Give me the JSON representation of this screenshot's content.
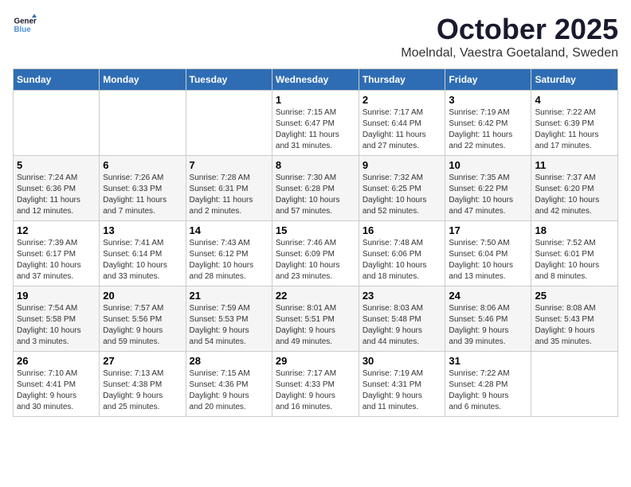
{
  "logo": {
    "line1": "General",
    "line2": "Blue"
  },
  "title": "October 2025",
  "location": "Moelndal, Vaestra Goetaland, Sweden",
  "headers": [
    "Sunday",
    "Monday",
    "Tuesday",
    "Wednesday",
    "Thursday",
    "Friday",
    "Saturday"
  ],
  "weeks": [
    [
      {
        "day": "",
        "info": ""
      },
      {
        "day": "",
        "info": ""
      },
      {
        "day": "",
        "info": ""
      },
      {
        "day": "1",
        "info": "Sunrise: 7:15 AM\nSunset: 6:47 PM\nDaylight: 11 hours\nand 31 minutes."
      },
      {
        "day": "2",
        "info": "Sunrise: 7:17 AM\nSunset: 6:44 PM\nDaylight: 11 hours\nand 27 minutes."
      },
      {
        "day": "3",
        "info": "Sunrise: 7:19 AM\nSunset: 6:42 PM\nDaylight: 11 hours\nand 22 minutes."
      },
      {
        "day": "4",
        "info": "Sunrise: 7:22 AM\nSunset: 6:39 PM\nDaylight: 11 hours\nand 17 minutes."
      }
    ],
    [
      {
        "day": "5",
        "info": "Sunrise: 7:24 AM\nSunset: 6:36 PM\nDaylight: 11 hours\nand 12 minutes."
      },
      {
        "day": "6",
        "info": "Sunrise: 7:26 AM\nSunset: 6:33 PM\nDaylight: 11 hours\nand 7 minutes."
      },
      {
        "day": "7",
        "info": "Sunrise: 7:28 AM\nSunset: 6:31 PM\nDaylight: 11 hours\nand 2 minutes."
      },
      {
        "day": "8",
        "info": "Sunrise: 7:30 AM\nSunset: 6:28 PM\nDaylight: 10 hours\nand 57 minutes."
      },
      {
        "day": "9",
        "info": "Sunrise: 7:32 AM\nSunset: 6:25 PM\nDaylight: 10 hours\nand 52 minutes."
      },
      {
        "day": "10",
        "info": "Sunrise: 7:35 AM\nSunset: 6:22 PM\nDaylight: 10 hours\nand 47 minutes."
      },
      {
        "day": "11",
        "info": "Sunrise: 7:37 AM\nSunset: 6:20 PM\nDaylight: 10 hours\nand 42 minutes."
      }
    ],
    [
      {
        "day": "12",
        "info": "Sunrise: 7:39 AM\nSunset: 6:17 PM\nDaylight: 10 hours\nand 37 minutes."
      },
      {
        "day": "13",
        "info": "Sunrise: 7:41 AM\nSunset: 6:14 PM\nDaylight: 10 hours\nand 33 minutes."
      },
      {
        "day": "14",
        "info": "Sunrise: 7:43 AM\nSunset: 6:12 PM\nDaylight: 10 hours\nand 28 minutes."
      },
      {
        "day": "15",
        "info": "Sunrise: 7:46 AM\nSunset: 6:09 PM\nDaylight: 10 hours\nand 23 minutes."
      },
      {
        "day": "16",
        "info": "Sunrise: 7:48 AM\nSunset: 6:06 PM\nDaylight: 10 hours\nand 18 minutes."
      },
      {
        "day": "17",
        "info": "Sunrise: 7:50 AM\nSunset: 6:04 PM\nDaylight: 10 hours\nand 13 minutes."
      },
      {
        "day": "18",
        "info": "Sunrise: 7:52 AM\nSunset: 6:01 PM\nDaylight: 10 hours\nand 8 minutes."
      }
    ],
    [
      {
        "day": "19",
        "info": "Sunrise: 7:54 AM\nSunset: 5:58 PM\nDaylight: 10 hours\nand 3 minutes."
      },
      {
        "day": "20",
        "info": "Sunrise: 7:57 AM\nSunset: 5:56 PM\nDaylight: 9 hours\nand 59 minutes."
      },
      {
        "day": "21",
        "info": "Sunrise: 7:59 AM\nSunset: 5:53 PM\nDaylight: 9 hours\nand 54 minutes."
      },
      {
        "day": "22",
        "info": "Sunrise: 8:01 AM\nSunset: 5:51 PM\nDaylight: 9 hours\nand 49 minutes."
      },
      {
        "day": "23",
        "info": "Sunrise: 8:03 AM\nSunset: 5:48 PM\nDaylight: 9 hours\nand 44 minutes."
      },
      {
        "day": "24",
        "info": "Sunrise: 8:06 AM\nSunset: 5:46 PM\nDaylight: 9 hours\nand 39 minutes."
      },
      {
        "day": "25",
        "info": "Sunrise: 8:08 AM\nSunset: 5:43 PM\nDaylight: 9 hours\nand 35 minutes."
      }
    ],
    [
      {
        "day": "26",
        "info": "Sunrise: 7:10 AM\nSunset: 4:41 PM\nDaylight: 9 hours\nand 30 minutes."
      },
      {
        "day": "27",
        "info": "Sunrise: 7:13 AM\nSunset: 4:38 PM\nDaylight: 9 hours\nand 25 minutes."
      },
      {
        "day": "28",
        "info": "Sunrise: 7:15 AM\nSunset: 4:36 PM\nDaylight: 9 hours\nand 20 minutes."
      },
      {
        "day": "29",
        "info": "Sunrise: 7:17 AM\nSunset: 4:33 PM\nDaylight: 9 hours\nand 16 minutes."
      },
      {
        "day": "30",
        "info": "Sunrise: 7:19 AM\nSunset: 4:31 PM\nDaylight: 9 hours\nand 11 minutes."
      },
      {
        "day": "31",
        "info": "Sunrise: 7:22 AM\nSunset: 4:28 PM\nDaylight: 9 hours\nand 6 minutes."
      },
      {
        "day": "",
        "info": ""
      }
    ]
  ]
}
